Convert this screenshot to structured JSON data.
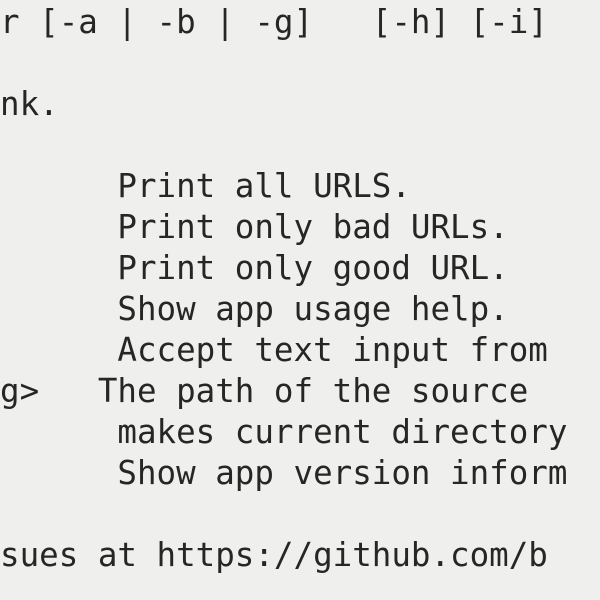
{
  "terminal": {
    "lines": [
      "r [-a | -b | -g]   [-h] [-i]",
      "",
      "nk.",
      "",
      "      Print all URLS.",
      "      Print only bad URLs.",
      "      Print only good URL.",
      "      Show app usage help.",
      "      Accept text input from",
      "g>   The path of the source",
      "      makes current directory",
      "      Show app version inform",
      "",
      "sues at https://github.com/b"
    ]
  }
}
